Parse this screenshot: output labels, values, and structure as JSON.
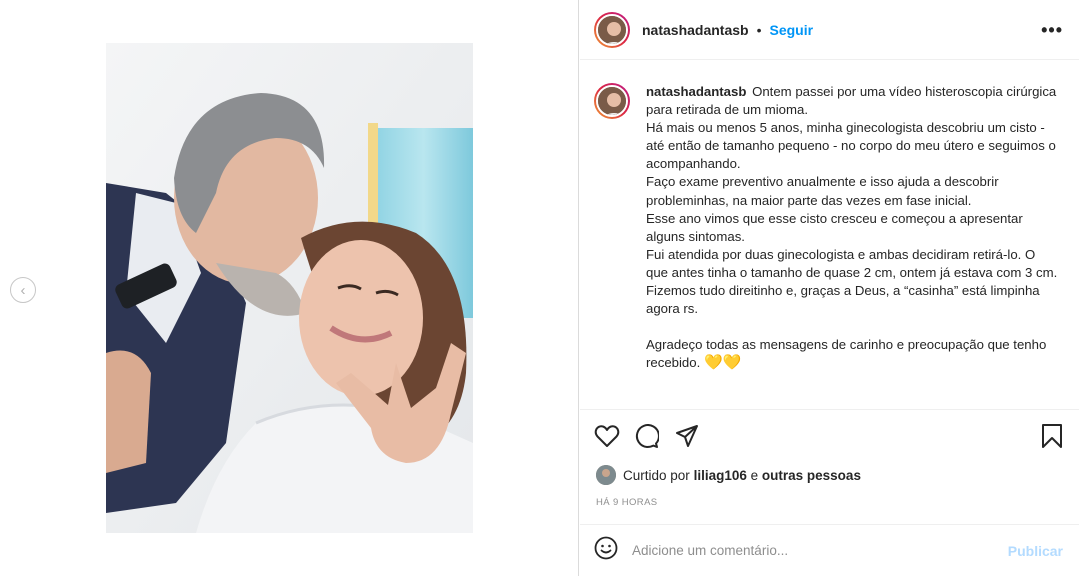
{
  "post": {
    "username": "natashadantasb",
    "separator": "•",
    "follow_label": "Seguir",
    "more_icon": "more-options-icon",
    "prev_icon": "chevron-left-icon"
  },
  "caption": {
    "username": "natashadantasb",
    "paragraphs": [
      "Ontem passei por uma vídeo histeroscopia cirúrgica para retirada de um mioma.",
      "Há mais ou menos 5 anos, minha ginecologista descobriu um cisto - até então de tamanho pequeno - no corpo do meu útero e seguimos o acompanhando.",
      "Faço exame preventivo anualmente e isso ajuda a descobrir probleminhas, na maior parte das vezes em fase inicial.",
      "Esse ano vimos que esse cisto cresceu e começou a apresentar alguns sintomas.",
      "Fui atendida por duas ginecologista e ambas decidiram retirá-lo. O que antes tinha o tamanho de quase 2 cm, ontem já estava com 3 cm.",
      "Fizemos tudo direitinho e, graças a Deus, a “casinha” está limpinha agora rs."
    ],
    "closing": "Agradeço todas as mensagens de carinho e preocupação que tenho recebido.",
    "emoji": "💛💛"
  },
  "actions": {
    "like_icon": "heart-icon",
    "comment_icon": "comment-icon",
    "share_icon": "share-icon",
    "save_icon": "bookmark-icon"
  },
  "likes": {
    "prefix": "Curtido por",
    "user": "liliag106",
    "middle": "e",
    "suffix": "outras pessoas"
  },
  "timestamp": "HÁ 9 HORAS",
  "comment": {
    "emoji_icon": "smiley-icon",
    "placeholder": "Adicione um comentário...",
    "publish_label": "Publicar"
  },
  "colors": {
    "accent": "#0095f6",
    "publish_disabled": "#b3dbff",
    "hearts": "#f5d000",
    "border": "#dbdbdb"
  }
}
